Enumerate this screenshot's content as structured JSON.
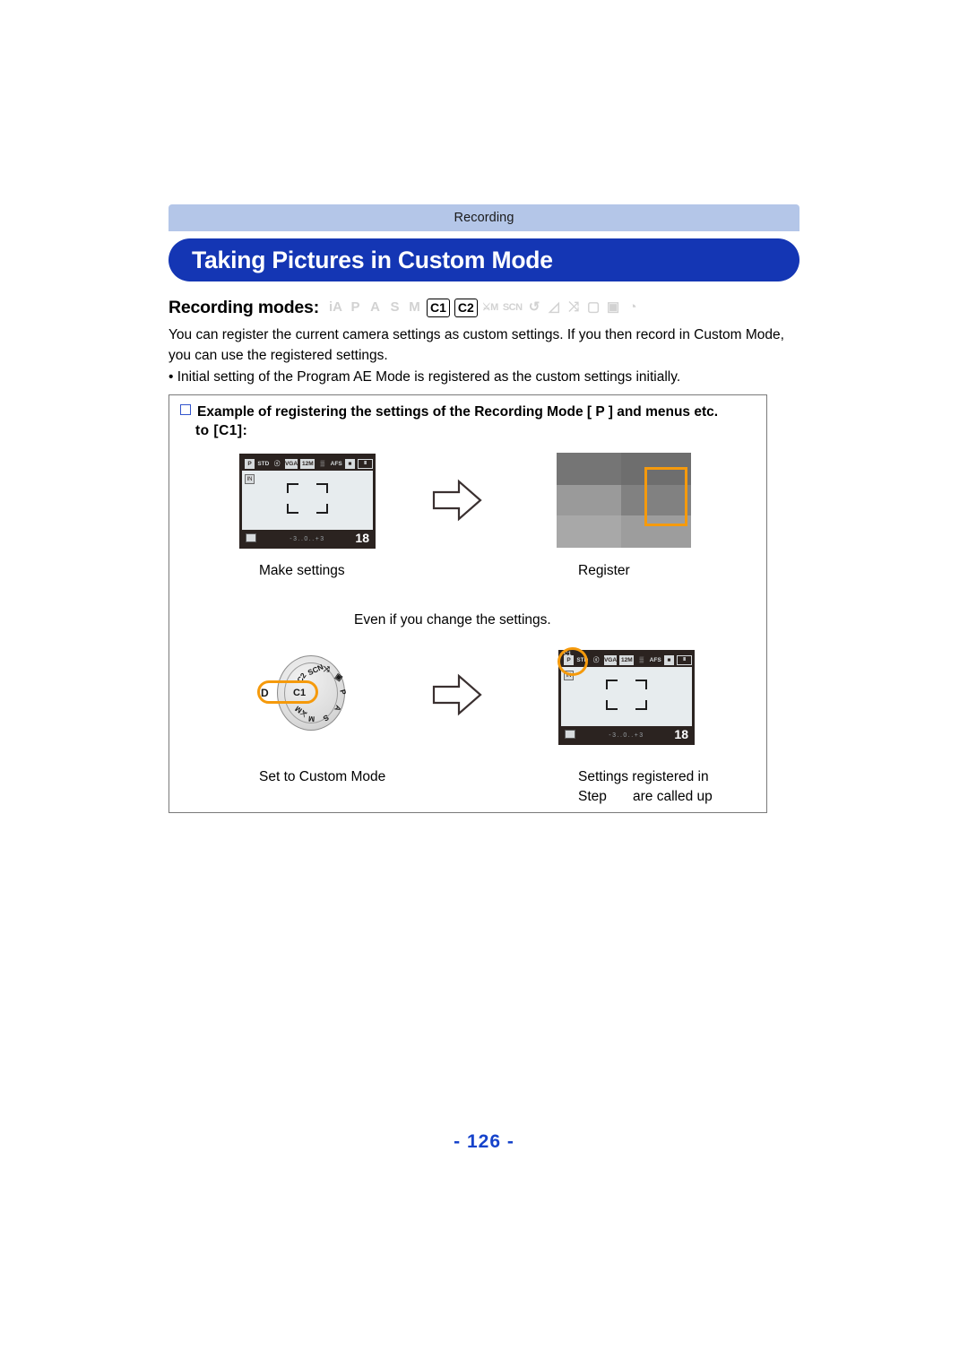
{
  "header": {
    "section_tab": "Recording",
    "title": "Taking Pictures in Custom Mode"
  },
  "recording_modes": {
    "label": "Recording modes:",
    "icons": [
      {
        "name": "intelligent-auto-mode-icon",
        "text": "iA",
        "state": "inactive"
      },
      {
        "name": "program-ae-mode-icon",
        "text": "P",
        "state": "inactive"
      },
      {
        "name": "aperture-priority-mode-icon",
        "text": "A",
        "state": "inactive"
      },
      {
        "name": "shutter-priority-mode-icon",
        "text": "S",
        "state": "inactive"
      },
      {
        "name": "manual-exposure-mode-icon",
        "text": "M",
        "state": "inactive"
      },
      {
        "name": "custom-mode-c1-icon",
        "text": "C1",
        "state": "active"
      },
      {
        "name": "custom-mode-c2-icon",
        "text": "C2",
        "state": "active"
      },
      {
        "name": "creative-video-mode-icon",
        "text": "⚔M",
        "state": "inactive"
      },
      {
        "name": "scene-mode-icon",
        "text": "SCN",
        "state": "inactive"
      },
      {
        "name": "panorama-mode-icon",
        "text": "↺",
        "state": "inactive"
      },
      {
        "name": "landscape-mode-icon",
        "text": "◿",
        "state": "inactive"
      },
      {
        "name": "sports-mode-icon",
        "text": "⤨",
        "state": "inactive"
      },
      {
        "name": "portrait-mode-icon",
        "text": "▢",
        "state": "inactive"
      },
      {
        "name": "night-portrait-mode-icon",
        "text": "▣",
        "state": "inactive"
      },
      {
        "name": "creative-control-mode-icon",
        "text": "◔",
        "state": "inactive"
      }
    ]
  },
  "intro": {
    "paragraph": "You can register the current camera settings as custom settings. If you then record in Custom Mode, you can use the registered settings.",
    "bullet": "• Initial setting of the Program AE Mode is registered as the custom settings initially."
  },
  "example": {
    "heading_line1": "Example of registering the settings of the Recording Mode [ P ] and menus etc.",
    "heading_line2": "to [C1]:",
    "captions": {
      "make_settings": "Make settings",
      "register": "Register",
      "even_if": "Even if you change the settings.",
      "set_custom": "Set to Custom Mode",
      "called_up_line1": "Settings registered in",
      "called_up_line2": "Step",
      "called_up_line3": "are called up"
    },
    "lcd_screen": {
      "mode_badge": "P",
      "custom_badge": "C1",
      "top_icons": [
        {
          "name": "photo-style-icon",
          "text": "STD"
        },
        {
          "name": "flash-off-icon",
          "text": "ⓢ"
        },
        {
          "name": "picture-quality-icon",
          "text": "VGA"
        },
        {
          "name": "picture-size-icon",
          "text": "12M"
        },
        {
          "name": "quality-fine-icon",
          "text": "▒"
        },
        {
          "name": "af-mode-icon",
          "text": "AFS"
        },
        {
          "name": "af-area-icon",
          "text": "■"
        },
        {
          "name": "battery-icon",
          "text": "III"
        }
      ],
      "left_icon": "IN",
      "metering_icon": "▣",
      "exposure_scale": "-3..0..+3",
      "shots_remaining": "18"
    },
    "mode_dial": {
      "center_label": "C1",
      "pointer_label": "D",
      "positions": [
        "C1",
        "C2",
        "SCN",
        "⤨",
        "▣",
        "P",
        "A",
        "S",
        "M",
        "⚔M"
      ]
    },
    "arrow_icon": "right-arrow-outline"
  },
  "footer": {
    "page_number": "- 126 -"
  },
  "colors": {
    "tab_blue": "#b4c6e8",
    "title_blue": "#1436b4",
    "highlight_orange": "#f59a0c",
    "page_number_blue": "#1643cb",
    "lcd_frame": "#2b2320",
    "lcd_screen": "#e7ecee"
  }
}
